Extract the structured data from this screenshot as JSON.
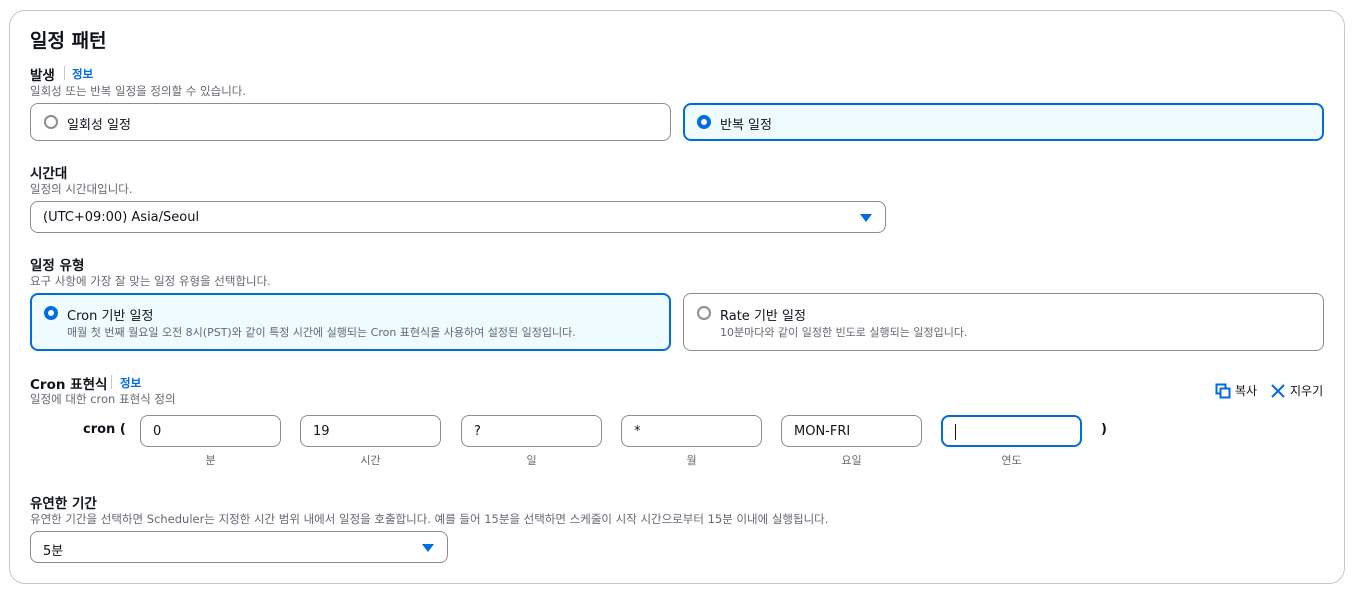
{
  "section": {
    "title": "일정 패턴"
  },
  "occurrence": {
    "label": "발생",
    "info": "정보",
    "description": "일회성 또는 반복 일정을 정의할 수 있습니다.",
    "options": [
      {
        "label": "일회성 일정",
        "selected": false
      },
      {
        "label": "반복 일정",
        "selected": true
      }
    ]
  },
  "timezone": {
    "label": "시간대",
    "description": "일정의 시간대입니다.",
    "value": "(UTC+09:00) Asia/Seoul"
  },
  "schedule_type": {
    "label": "일정 유형",
    "description": "요구 사항에 가장 잘 맞는 일정 유형을 선택합니다.",
    "options": [
      {
        "label": "Cron 기반 일정",
        "description": "매월 첫 번째 월요일 오전 8시(PST)와 같이 특정 시간에 실행되는 Cron 표현식을 사용하여 설정된 일정입니다.",
        "selected": true
      },
      {
        "label": "Rate 기반 일정",
        "description": "10분마다와 같이 일정한 빈도로 실행되는 일정입니다.",
        "selected": false
      }
    ]
  },
  "cron": {
    "label": "Cron 표현식",
    "info": "정보",
    "description": "일정에 대한 cron 표현식 정의",
    "copy_label": "복사",
    "clear_label": "지우기",
    "prefix": "cron (",
    "suffix": ")",
    "fields": [
      {
        "value": "0",
        "label": "분"
      },
      {
        "value": "19",
        "label": "시간"
      },
      {
        "value": "?",
        "label": "일"
      },
      {
        "value": "*",
        "label": "월"
      },
      {
        "value": "MON-FRI",
        "label": "요일"
      },
      {
        "value": "",
        "label": "연도"
      }
    ]
  },
  "flexible_window": {
    "label": "유연한 기간",
    "description": "유연한 기간을 선택하면 Scheduler는 지정한 시간 범위 내에서 일정을 호출합니다. 예를 들어 15분을 선택하면 스케줄이 시작 시간으로부터 15분 이내에 실행됩니다.",
    "value": "5분"
  },
  "colors": {
    "accent": "#006ce0",
    "selected_bg": "#f0fbff",
    "border": "#8c8c94"
  }
}
